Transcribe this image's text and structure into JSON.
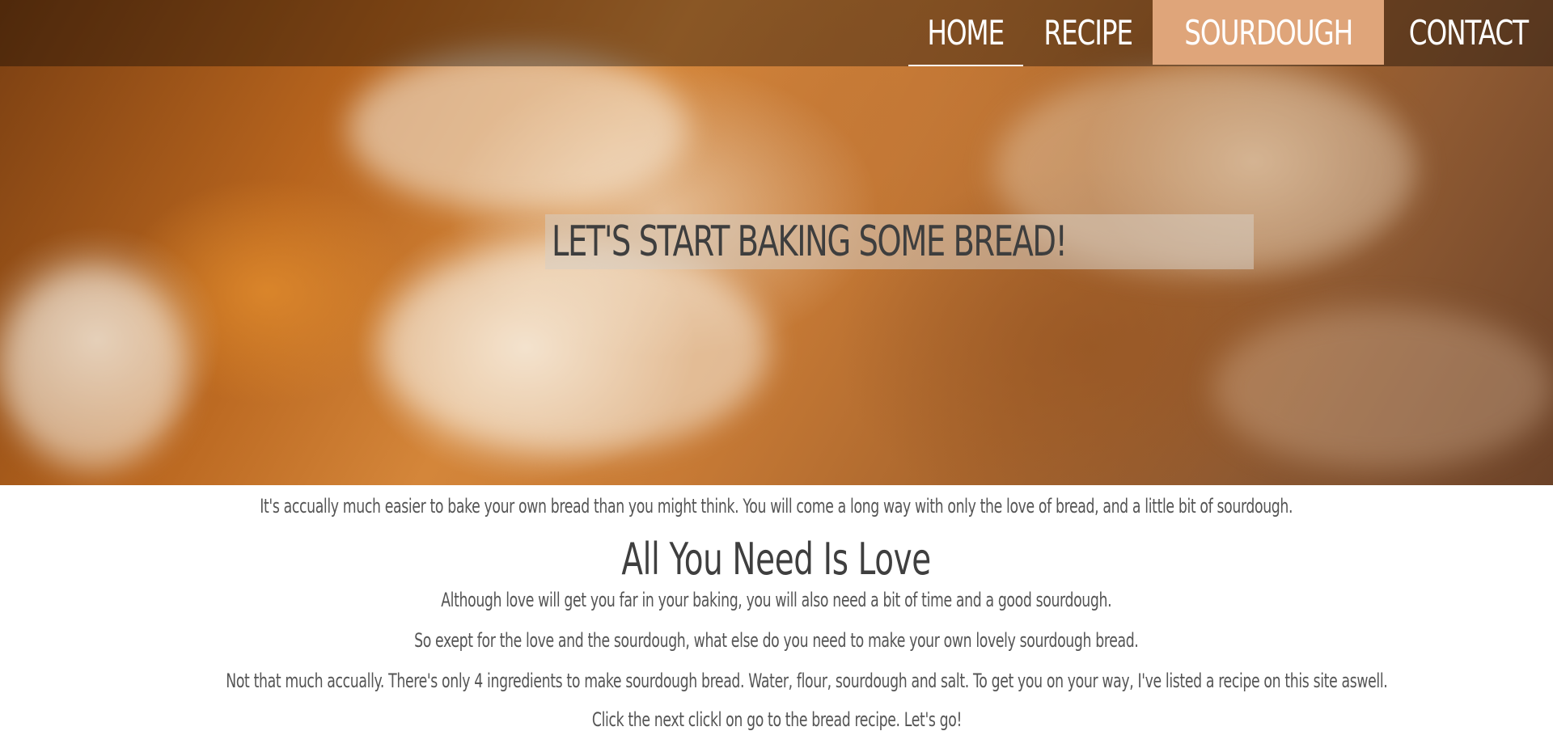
{
  "nav": {
    "items": [
      {
        "label": "HOME",
        "state": "active"
      },
      {
        "label": "RECIPE",
        "state": "normal"
      },
      {
        "label": "SOURDOUGH",
        "state": "highlight"
      },
      {
        "label": "CONTACT",
        "state": "normal"
      }
    ],
    "highlight_color": "#dfa57a"
  },
  "hero": {
    "title": "LET'S START BAKING SOME BREAD!"
  },
  "main": {
    "intro": "It's accually much easier to bake your own bread than you might think. You will come a long way with only the love of bread, and a little bit of sourdough.",
    "heading": "All You Need Is Love",
    "paragraphs": [
      "Although love will get you far in your baking, you will also need a bit of time and a good sourdough.",
      "So exept for the love and the sourdough, what else do you need to make your own lovely sourdough bread.",
      "Not that much accually. There's only 4 ingredients to make sourdough bread. Water, flour, sourdough and salt. To get you on your way, I've listed a recipe on this site aswell.",
      "Click the next clickl on go to the bread recipe. Let's go!"
    ]
  }
}
